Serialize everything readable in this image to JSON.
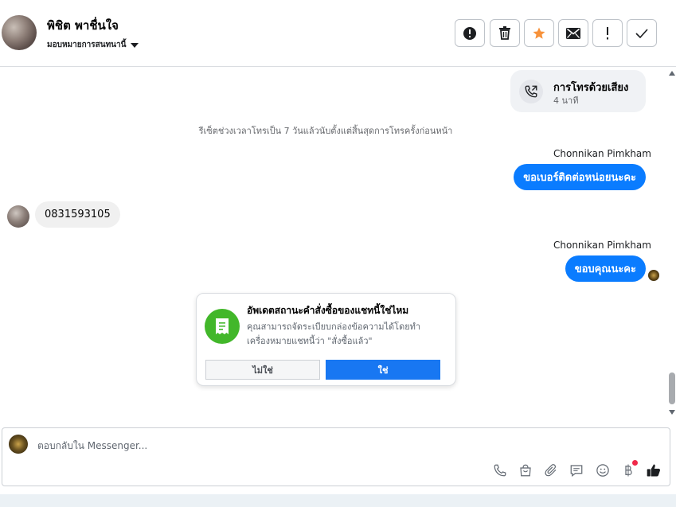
{
  "header": {
    "contact_name": "พิชิต พาชื่นใจ",
    "assign_label": "มอบหมายการสนทนานี้",
    "actions": [
      {
        "name": "mark-spam",
        "icon": "alert-circle-icon"
      },
      {
        "name": "delete",
        "icon": "trash-icon"
      },
      {
        "name": "star",
        "icon": "star-icon",
        "color": "#f7923b"
      },
      {
        "name": "mark-unread",
        "icon": "envelope-icon"
      },
      {
        "name": "follow-up",
        "icon": "exclamation-icon"
      },
      {
        "name": "done",
        "icon": "checkmark-icon"
      }
    ]
  },
  "conversation": {
    "call_card": {
      "title": "การโทรด้วยเสียง",
      "duration": "4 นาที",
      "icon": "phone-call-icon"
    },
    "system_note": "รีเซ็ตช่วงเวลาโทรเป็น 7 วันแล้วนับตั้งแต่สิ้นสุดการโทรครั้งก่อนหน้า",
    "messages": [
      {
        "direction": "outgoing",
        "sender": "Chonnikan Pimkham",
        "text": "ขอเบอร์ติดต่อหน่อยนะคะ"
      },
      {
        "direction": "incoming",
        "sender": "",
        "text": "0831593105"
      },
      {
        "direction": "outgoing",
        "sender": "Chonnikan Pimkham",
        "text": "ขอบคุณนะคะ"
      }
    ]
  },
  "order_prompt": {
    "title": "อัพเดตสถานะคำสั่งซื้อของแชทนี้ใช่ไหม",
    "description": "คุณสามารถจัดระเบียบกล่องข้อความได้โดยทำเครื่องหมายแชทนี้ว่า \"สั่งซื้อแล้ว\"",
    "no_label": "ไม่ใช่",
    "yes_label": "ใช่",
    "icon": "receipt-icon",
    "icon_color": "#42b72a"
  },
  "composer": {
    "placeholder": "ตอบกลับใน Messenger...",
    "tools": [
      "phone-icon",
      "shopping-bag-icon",
      "paperclip-icon",
      "chat-bubble-icon",
      "smiley-icon",
      "baht-icon",
      "thumbs-up-icon"
    ]
  },
  "colors": {
    "accent": "#0a7cff",
    "primary_button": "#1877f2",
    "notification_dot": "#f02849"
  }
}
